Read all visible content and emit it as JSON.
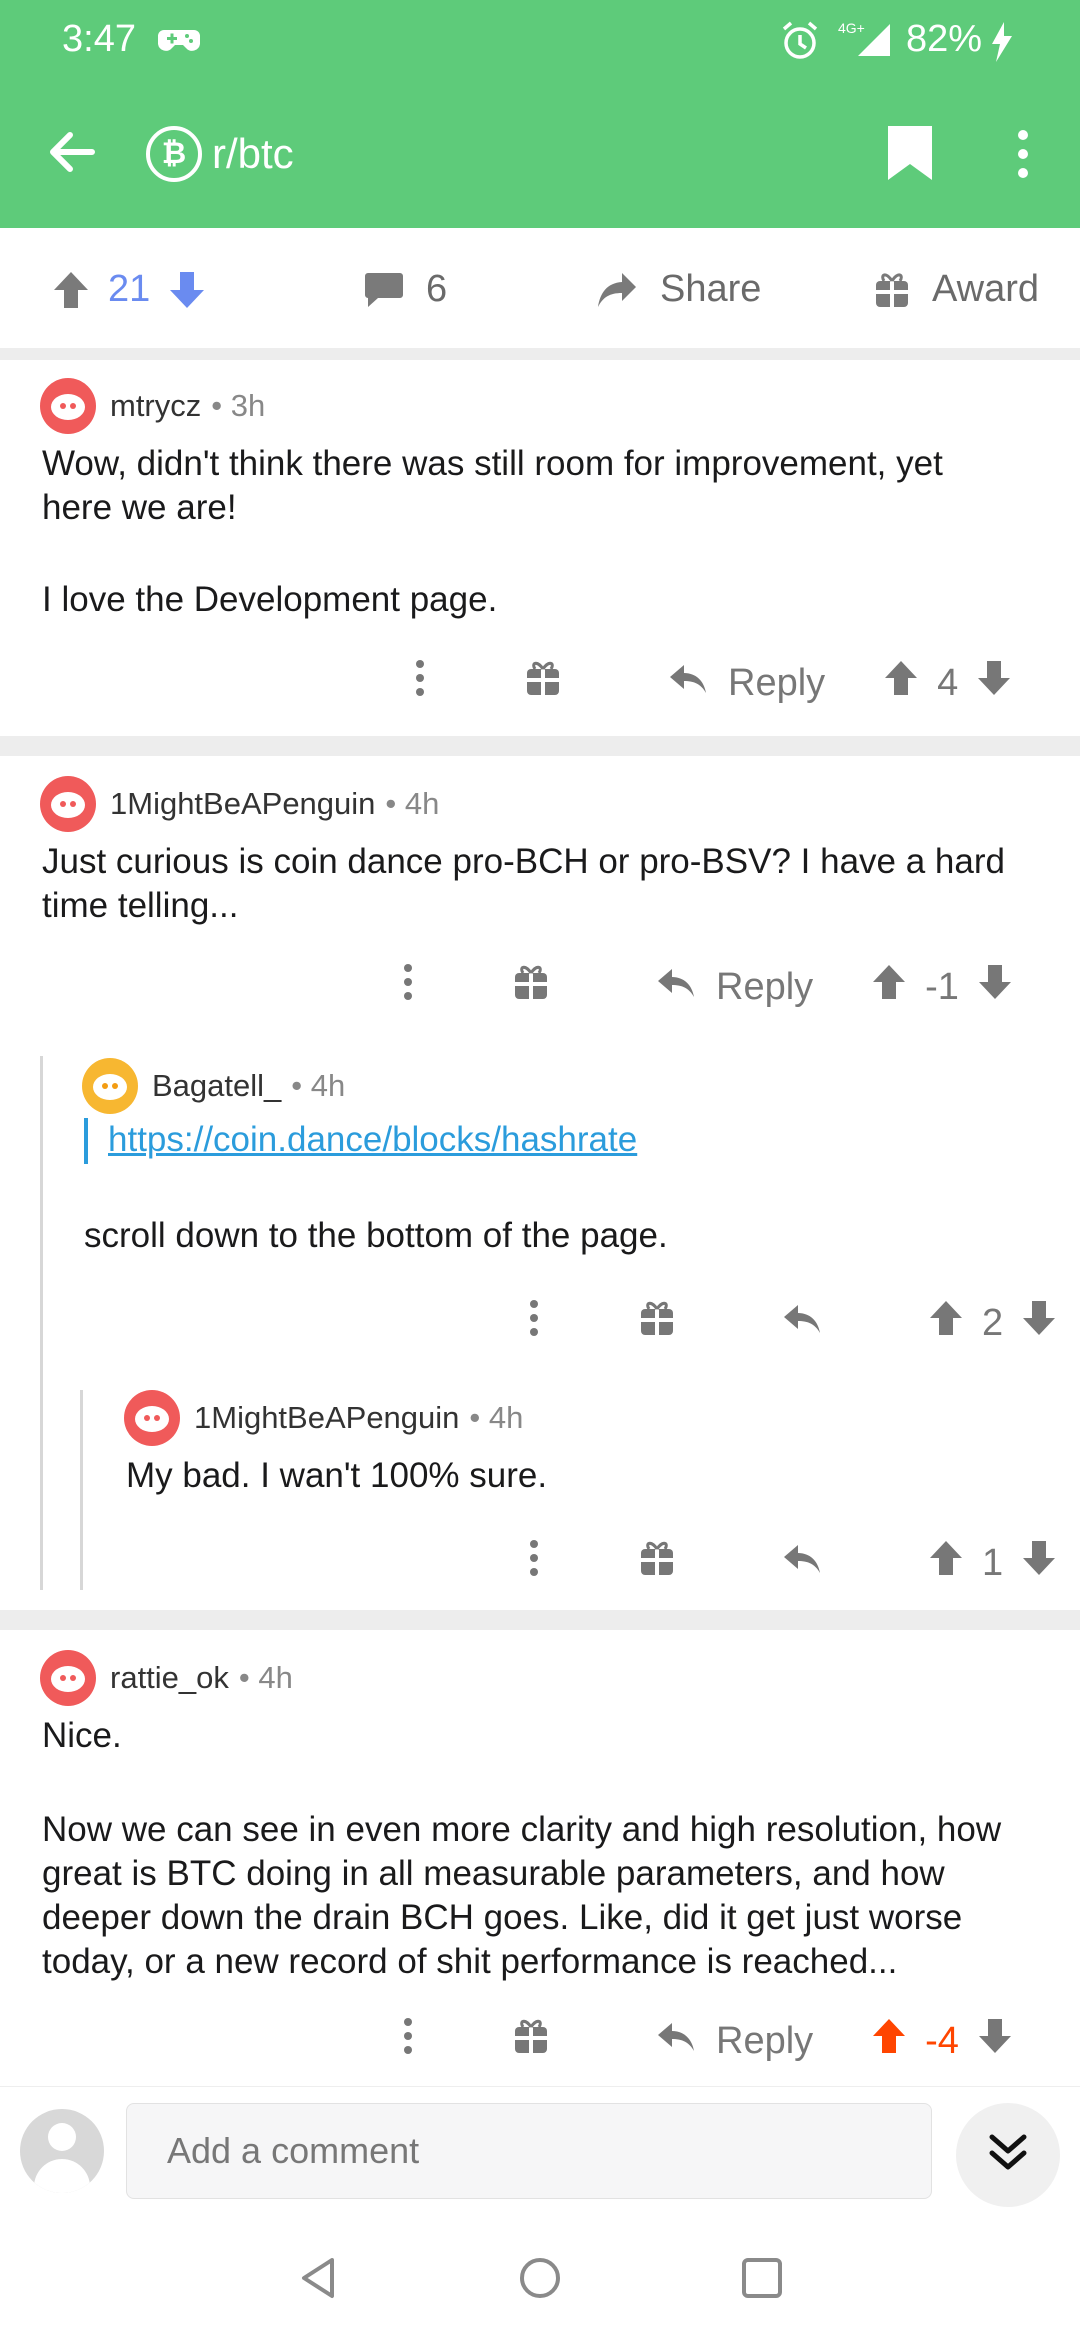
{
  "status_bar": {
    "time": "3:47",
    "network": "4G+",
    "battery": "82%"
  },
  "app_bar": {
    "subreddit_badge": "₿",
    "subreddit": "r/btc"
  },
  "post_actions": {
    "score": "21",
    "comments": "6",
    "share": "Share",
    "award": "Award"
  },
  "comments": [
    {
      "author": "mtrycz",
      "time": "• 3h",
      "body": [
        "Wow, didn't think there was still room for improvement, yet",
        "here we are!",
        "",
        "I love the Development page."
      ],
      "reply": "Reply",
      "score": "4"
    },
    {
      "author": "1MightBeAPenguin",
      "time": "• 4h",
      "body": [
        "Just curious is coin dance pro-BCH or pro-BSV? I have a hard",
        "time telling..."
      ],
      "reply": "Reply",
      "score": "-1"
    },
    {
      "author": "Bagatell_",
      "time": "• 4h",
      "link": "https://coin.dance/blocks/hashrate",
      "body": [
        "scroll down to the bottom of the page."
      ],
      "score": "2"
    },
    {
      "author": "1MightBeAPenguin",
      "time": "• 4h",
      "body": [
        "My bad. I wan't 100% sure."
      ],
      "score": "1"
    },
    {
      "author": "rattie_ok",
      "time": "• 4h",
      "body": [
        "Nice.",
        "",
        "Now we can see in even more clarity and high resolution, how",
        "great is BTC doing in all measurable parameters, and how",
        "deeper down the drain BCH goes. Like, did it get just worse",
        "today, or a new record of shit performance is reached..."
      ],
      "reply": "Reply",
      "score": "-4"
    }
  ],
  "composer": {
    "placeholder": "Add a comment"
  },
  "colors": {
    "brand_green": "#5ecb7a",
    "upvote_blue": "#6a8bf0",
    "link_blue": "#2b9cdc",
    "downvoted_orange": "#ff4500"
  }
}
